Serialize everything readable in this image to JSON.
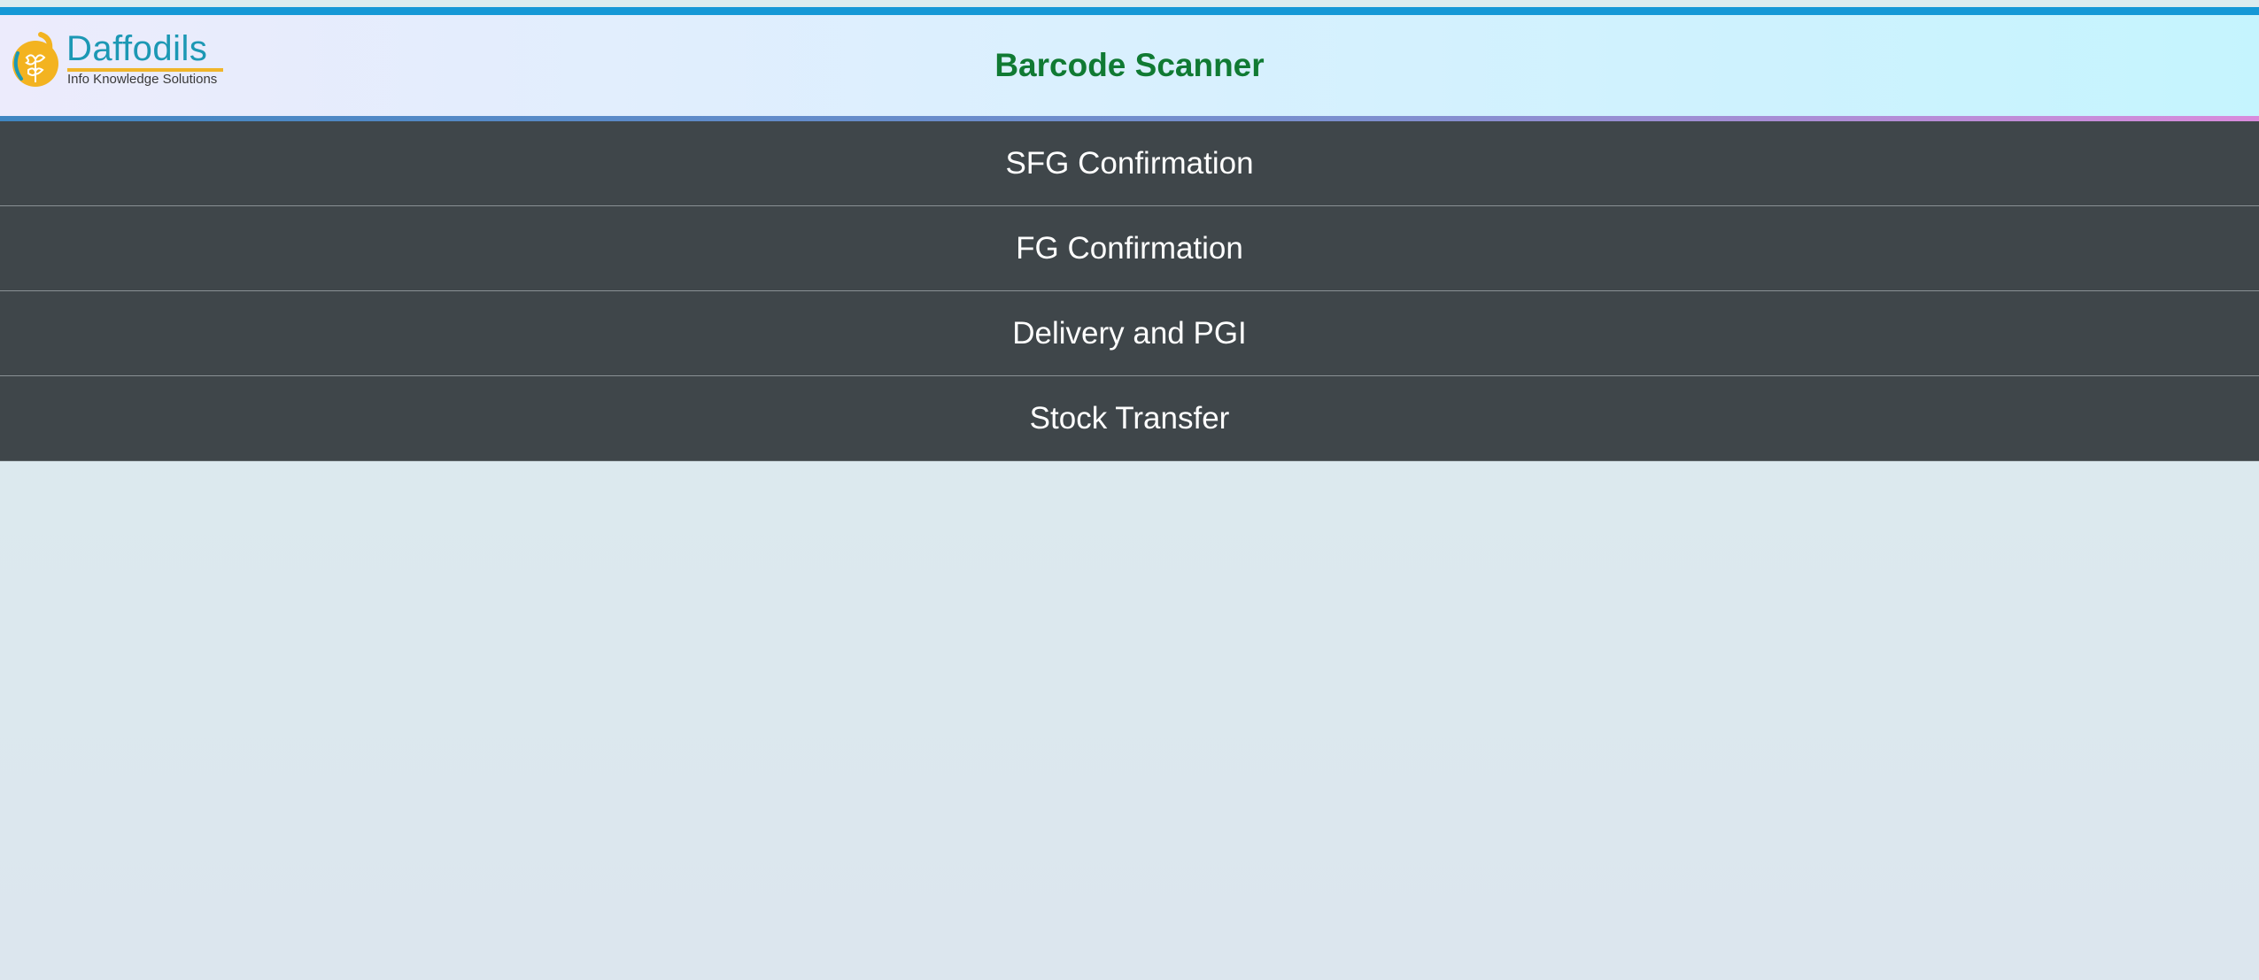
{
  "header": {
    "title": "Barcode Scanner",
    "logo": {
      "name": "Daffodils",
      "tagline": "Info Knowledge Solutions",
      "icon": "daffodil-flower-icon"
    }
  },
  "menu": {
    "items": [
      {
        "label": "SFG Confirmation"
      },
      {
        "label": "FG Confirmation"
      },
      {
        "label": "Delivery and PGI"
      },
      {
        "label": "Stock Transfer"
      }
    ]
  },
  "colors": {
    "title": "#107a33",
    "menu_background": "#3f464a",
    "top_strip": "#1598d6",
    "logo_text": "#1c98b4",
    "logo_accent": "#f0b52a"
  }
}
